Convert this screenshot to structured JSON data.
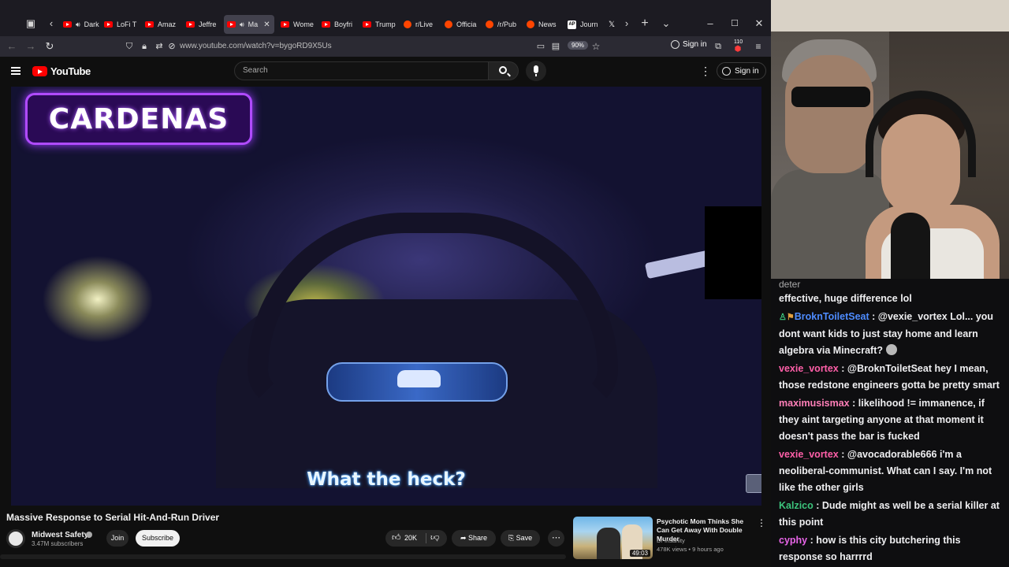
{
  "browser": {
    "tabs": [
      {
        "label": "Dark S",
        "favicon": "youtube-icon",
        "audio": true
      },
      {
        "label": "LoFi T",
        "favicon": "youtube-icon",
        "audio": false
      },
      {
        "label": "Amaz",
        "favicon": "youtube-icon",
        "audio": false
      },
      {
        "label": "Jeffre",
        "favicon": "youtube-icon",
        "audio": false
      },
      {
        "label": "Ma",
        "favicon": "youtube-icon",
        "audio": true,
        "active": true
      },
      {
        "label": "Wome",
        "favicon": "youtube-icon",
        "audio": false
      },
      {
        "label": "Boyfri",
        "favicon": "youtube-icon",
        "audio": false
      },
      {
        "label": "Trump",
        "favicon": "youtube-icon",
        "audio": false
      },
      {
        "label": "r/Live",
        "favicon": "reddit-icon",
        "audio": false
      },
      {
        "label": "Officia",
        "favicon": "reddit-icon",
        "audio": false
      },
      {
        "label": "/r/Pub",
        "favicon": "reddit-icon",
        "audio": false
      },
      {
        "label": "News",
        "favicon": "reddit-icon",
        "audio": false
      },
      {
        "label": "Journ",
        "favicon": "ap-icon",
        "audio": false
      },
      {
        "label": "",
        "favicon": "x-icon",
        "audio": false
      }
    ],
    "url": "www.youtube.com/watch?v=bygoRD9X5Us",
    "zoom": "90%",
    "sign_in": "Sign in",
    "extension_badge": "110"
  },
  "youtube": {
    "logo_text": "YouTube",
    "search_placeholder": "Search",
    "sign_in": "Sign in"
  },
  "video": {
    "overlay_name": "CARDENAS",
    "subtitle": "What the heck?",
    "title": "Massive Response to Serial Hit-And-Run Driver",
    "channel": "Midwest Safety",
    "subscribers": "3.47M subscribers",
    "join_label": "Join",
    "subscribe_label": "Subscribe",
    "likes": "20K",
    "share_label": "Share",
    "save_label": "Save"
  },
  "recommendation": {
    "title": "Psychotic Mom Thinks She Can Get Away With Double Murder",
    "channel": "Dr Insanity",
    "meta": "478K views • 9 hours ago",
    "duration": "49:03"
  },
  "chat": {
    "partial_top": "deter",
    "messages": [
      {
        "user": "",
        "color": "#efeff1",
        "text": "effective, huge difference lol",
        "badges": false,
        "emote": false
      },
      {
        "user": "BroknToiletSeat",
        "color": "#4e8cff",
        "text": "@vexie_vortex Lol... you dont want kids to just stay home and learn algebra via Minecraft?",
        "badges": true,
        "emote": true
      },
      {
        "user": "vexie_vortex",
        "color": "#ff5fa8",
        "text": "@BroknToiletSeat hey I mean, those redstone engineers gotta be pretty smart",
        "badges": false,
        "emote": false
      },
      {
        "user": "maximusismax",
        "color": "#ff7fb8",
        "text": "likelihood != immanence, if they aint targeting anyone at that moment it doesn't pass the bar is fucked",
        "badges": false,
        "emote": false
      },
      {
        "user": "vexie_vortex",
        "color": "#ff5fa8",
        "text": "@avocadorable666 i'm a neoliberal-communist. What can I say. I'm not like the other girls",
        "badges": false,
        "emote": false
      },
      {
        "user": "Kalzico",
        "color": "#3cc47c",
        "text": "Dude might as well be a serial killer at this point",
        "badges": false,
        "emote": false
      },
      {
        "user": "cyphy",
        "color": "#e865e8",
        "text": "how is this city butchering this response so harrrrd",
        "badges": false,
        "emote": false
      }
    ]
  }
}
